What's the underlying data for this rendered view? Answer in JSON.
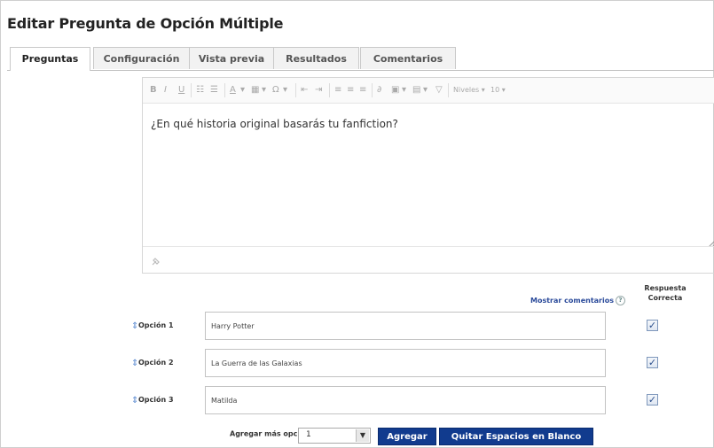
{
  "page": {
    "title": "Editar Pregunta de Opción Múltiple"
  },
  "tabs": [
    {
      "label": "Preguntas",
      "active": true
    },
    {
      "label": "Configuración",
      "active": false
    },
    {
      "label": "Vista previa",
      "active": false
    },
    {
      "label": "Resultados",
      "active": false
    },
    {
      "label": "Comentarios",
      "active": false
    }
  ],
  "editor": {
    "toolbar": {
      "bold": "B",
      "italic": "I",
      "underline": "U",
      "format_label": "Niveles",
      "size_label": "10"
    },
    "content": "¿En qué historia original basarás tu fanfiction?"
  },
  "comments": {
    "link_label": "Mostrar comentarios",
    "help_glyph": "?"
  },
  "correct_answer_header": "Respuesta Correcta",
  "options": [
    {
      "label": "Opción 1",
      "value": "Harry Potter",
      "correct": true
    },
    {
      "label": "Opción 2",
      "value": "La Guerra de las Galaxias",
      "correct": true
    },
    {
      "label": "Opción 3",
      "value": "Matilda",
      "correct": true
    }
  ],
  "footer": {
    "add_more_label": "Agregar más opciones:",
    "quantity": "1",
    "add_button": "Agregar",
    "remove_blank_button": "Quitar Espacios en Blanco"
  },
  "colors": {
    "primary_button": "#113b8e",
    "link": "#2a4a9a"
  },
  "icons": [
    "pin-icon",
    "help-icon",
    "drag-handle-icon",
    "dropdown-arrow-icon",
    "checkbox-icon"
  ]
}
